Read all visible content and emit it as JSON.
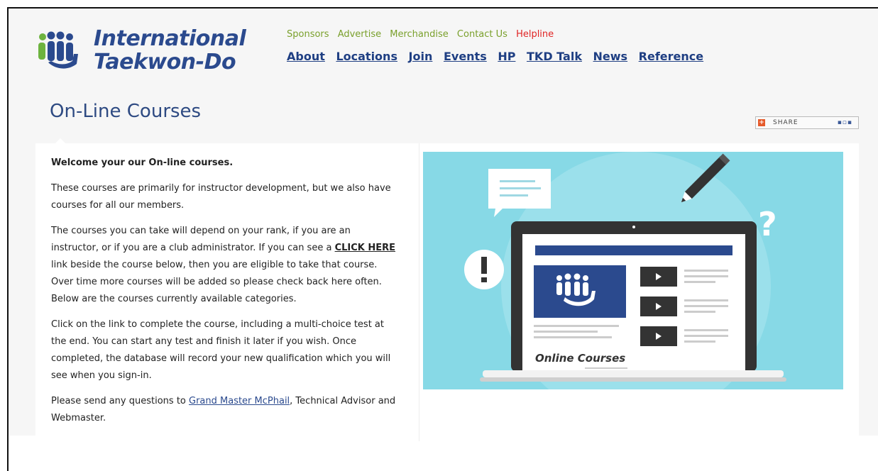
{
  "header": {
    "brand_line1": "International",
    "brand_line2": "Taekwon-Do",
    "top_links": [
      "Sponsors",
      "Advertise",
      "Merchandise",
      "Contact Us",
      "Helpline"
    ],
    "main_links": [
      "About",
      "Locations",
      "Join",
      "Events",
      "HP",
      "TKD Talk",
      "News",
      "Reference"
    ]
  },
  "page": {
    "title": "On-Line Courses",
    "share_label": "SHARE"
  },
  "content": {
    "welcome": "Welcome your our On-line courses.",
    "p1": "These courses are primarily for instructor development, but we also have courses for all our members.",
    "p2_a": "The courses you can take will depend on your rank, if you are an instructor, or if you are a club administrator. If you can see a ",
    "p2_link": "CLICK HERE",
    "p2_b": " link beside the course below, then you are eligible to take that course. Over time more courses will be added so please check back here often. Below are the courses currently available categories.",
    "p3": "Click on the link to complete the course, including a multi-choice test at the end. You can start any test and finish it later if you wish. Once completed, the database will record your new qualification which you will see when you sign-in.",
    "p4_a": "Please send any questions to ",
    "p4_link": "Grand Master McPhail",
    "p4_b": ", Technical Advisor and Webmaster."
  },
  "illustration": {
    "label": "Online Courses"
  },
  "colors": {
    "brand_blue": "#2b4a8e",
    "nav_green": "#7aa02c",
    "helpline_red": "#e02424",
    "illustration_bg": "#87d9e6"
  }
}
